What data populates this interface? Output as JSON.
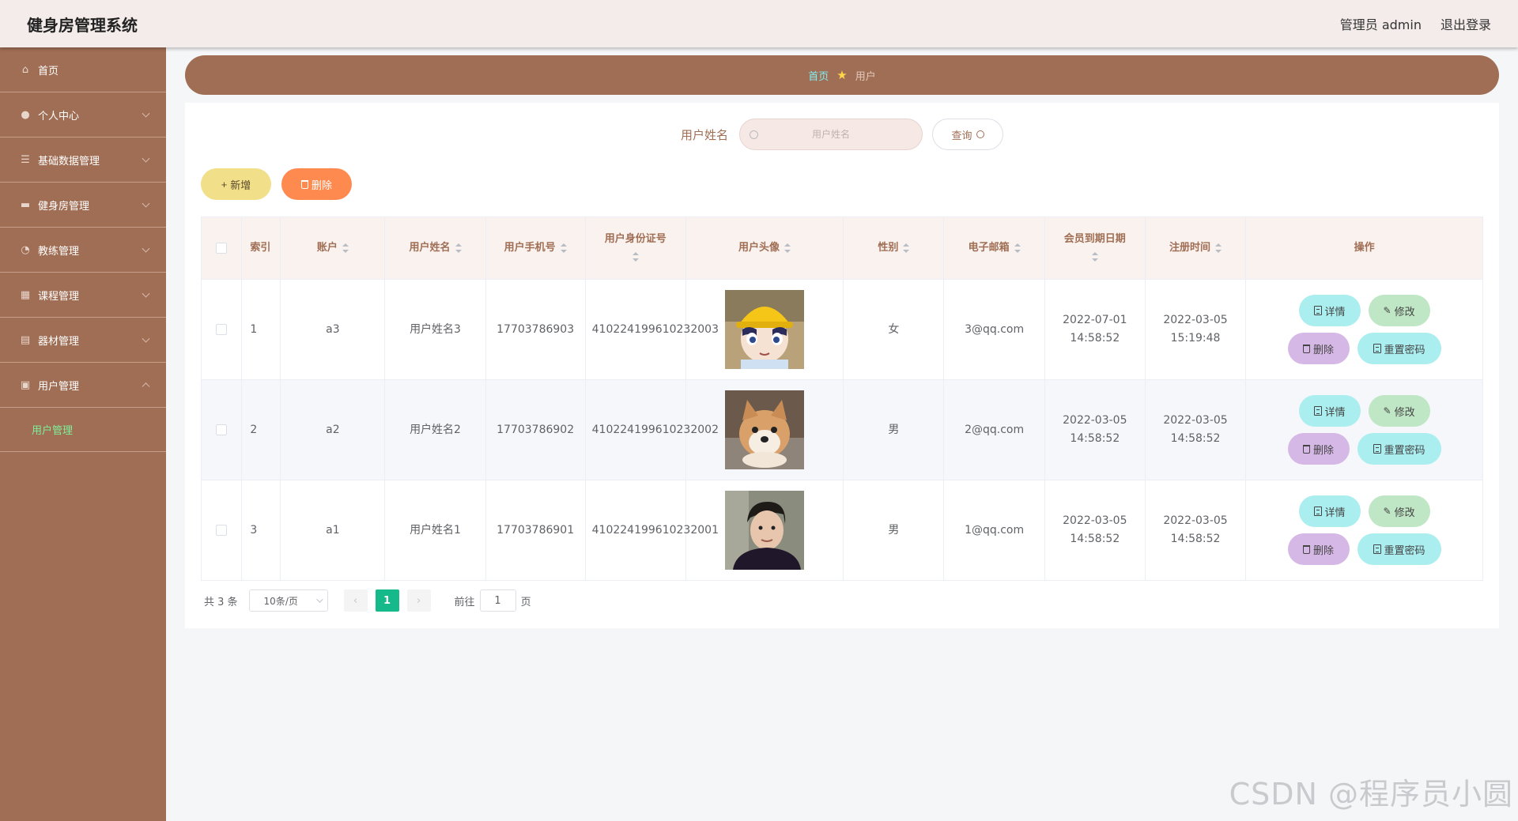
{
  "header": {
    "title": "健身房管理系统",
    "admin_label": "管理员 admin",
    "logout_label": "退出登录"
  },
  "sidebar": {
    "items": [
      {
        "label": "首页",
        "icon": "home-icon",
        "glyph": "⌂",
        "has_arrow": false
      },
      {
        "label": "个人中心",
        "icon": "user-icon",
        "glyph": "●",
        "has_arrow": true
      },
      {
        "label": "基础数据管理",
        "icon": "list-icon",
        "glyph": "☰",
        "has_arrow": true
      },
      {
        "label": "健身房管理",
        "icon": "card-icon",
        "glyph": "▬",
        "has_arrow": true
      },
      {
        "label": "教练管理",
        "icon": "compass-icon",
        "glyph": "◔",
        "has_arrow": true
      },
      {
        "label": "课程管理",
        "icon": "grid-icon",
        "glyph": "▦",
        "has_arrow": true
      },
      {
        "label": "器材管理",
        "icon": "tool-icon",
        "glyph": "▤",
        "has_arrow": true
      },
      {
        "label": "用户管理",
        "icon": "document-icon",
        "glyph": "▣",
        "has_arrow": true,
        "expanded": true
      }
    ],
    "sub_item": "用户管理"
  },
  "breadcrumb": {
    "home": "首页",
    "current": "用户",
    "separator_icon": "star-icon"
  },
  "search": {
    "label": "用户姓名",
    "placeholder": "用户姓名",
    "value": "",
    "button": "查询"
  },
  "actions": {
    "add": "新增",
    "delete": "删除"
  },
  "table": {
    "columns": [
      "索引",
      "账户",
      "用户姓名",
      "用户手机号",
      "用户身份证号",
      "用户头像",
      "性别",
      "电子邮箱",
      "会员到期日期",
      "注册时间",
      "操作"
    ],
    "rows": [
      {
        "index": "1",
        "account": "a3",
        "name": "用户姓名3",
        "phone": "17703786903",
        "id_card": "410224199610232003",
        "avatar": "cartoon-boy-yellow-hat",
        "gender": "女",
        "email": "3@qq.com",
        "expire": "2022-07-01 14:58:52",
        "register": "2022-03-05 15:19:48"
      },
      {
        "index": "2",
        "account": "a2",
        "name": "用户姓名2",
        "phone": "17703786902",
        "id_card": "410224199610232002",
        "avatar": "shiba-dog",
        "gender": "男",
        "email": "2@qq.com",
        "expire": "2022-03-05 14:58:52",
        "register": "2022-03-05 14:58:52"
      },
      {
        "index": "3",
        "account": "a1",
        "name": "用户姓名1",
        "phone": "17703786901",
        "id_card": "410224199610232001",
        "avatar": "young-man-portrait",
        "gender": "男",
        "email": "1@qq.com",
        "expire": "2022-03-05 14:58:52",
        "register": "2022-03-05 14:58:52"
      }
    ],
    "ops": {
      "detail": "详情",
      "edit": "修改",
      "remove": "删除",
      "reset": "重置密码"
    }
  },
  "pagination": {
    "total": "共 3 条",
    "page_size": "10条/页",
    "current": "1",
    "goto": "前往",
    "goto_value": "1",
    "page_unit": "页"
  },
  "watermark": "CSDN @程序员小圆",
  "colors": {
    "brand": "#a06e54",
    "header_bg": "#f3ecea",
    "active_page": "#16b98a",
    "add": "#f1df8a",
    "delete": "#ff8a4f"
  }
}
